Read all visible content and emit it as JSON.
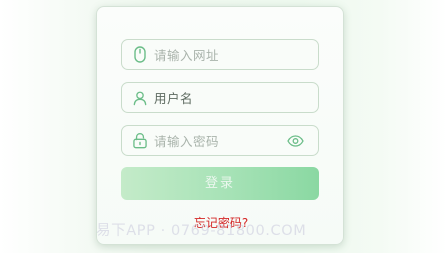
{
  "form": {
    "url_placeholder": "请输入网址",
    "username_value": "用户名",
    "password_placeholder": "请输入密码",
    "login_label": "登录",
    "forgot_label": "忘记密码?"
  },
  "watermark": "易下APP · 0769-81800.COM",
  "colors": {
    "accent": "#57b87a",
    "button_start": "#c4ebc9",
    "button_end": "#8ad8a2",
    "forgot_text": "#d42525"
  },
  "icons": {
    "url_field": "mouse-icon",
    "username_field": "user-icon",
    "password_field": "lock-icon",
    "toggle": "eye-icon"
  }
}
